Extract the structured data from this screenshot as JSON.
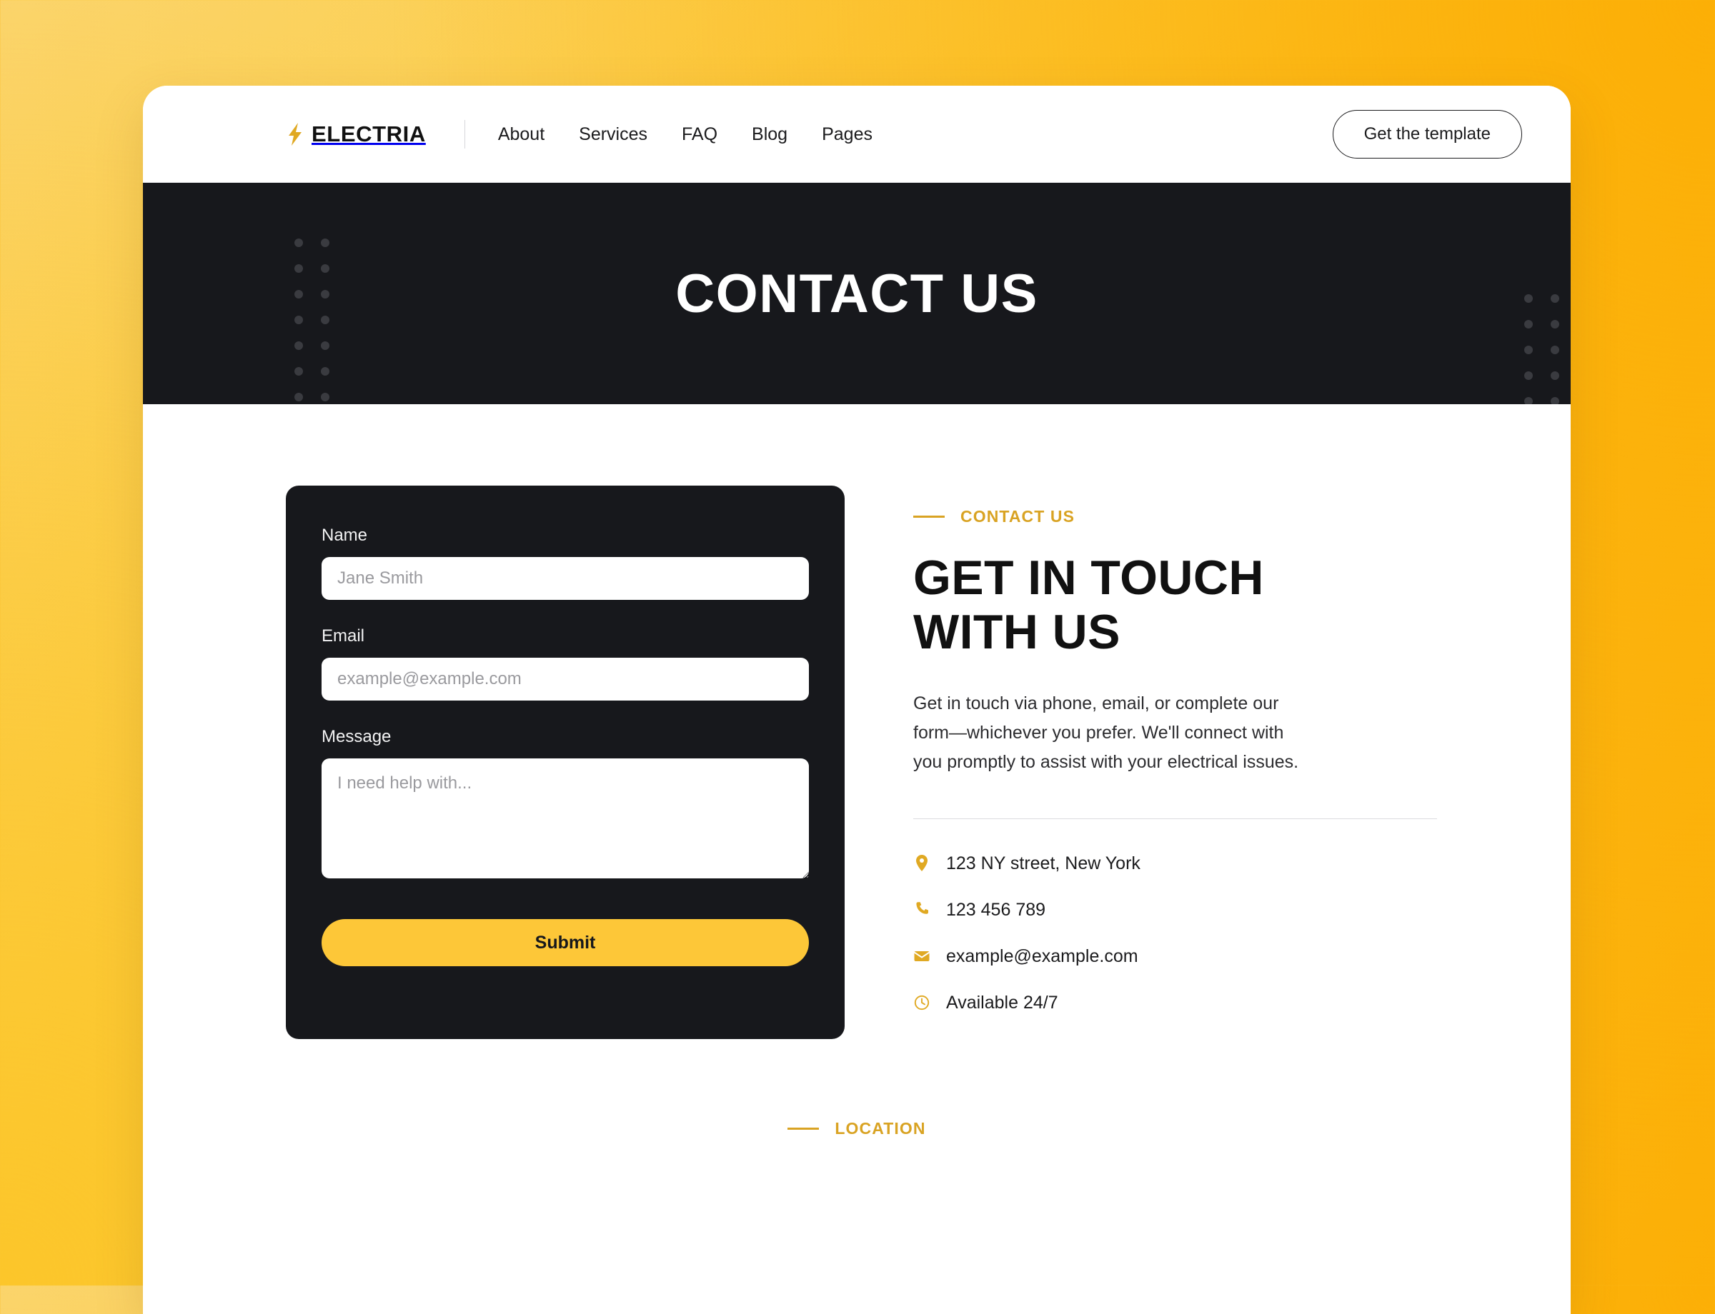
{
  "theme": {
    "accent": "#FDC738",
    "accent_dark": "#D9A323",
    "dark": "#17181c",
    "page_bg_top_left": "#FBD46B",
    "page_bg_top_right": "#FCAF06"
  },
  "header": {
    "brand": {
      "name": "ELECTRIA",
      "icon": "lightning-bolt-icon"
    },
    "nav": [
      {
        "label": "About"
      },
      {
        "label": "Services"
      },
      {
        "label": "FAQ"
      },
      {
        "label": "Blog"
      },
      {
        "label": "Pages"
      }
    ],
    "cta": {
      "label": "Get the template"
    }
  },
  "hero": {
    "title": "CONTACT US"
  },
  "form": {
    "name": {
      "label": "Name",
      "placeholder": "Jane Smith",
      "value": ""
    },
    "email": {
      "label": "Email",
      "placeholder": "example@example.com",
      "value": ""
    },
    "message": {
      "label": "Message",
      "placeholder": "I need help with...",
      "value": ""
    },
    "submit_label": "Submit"
  },
  "info": {
    "eyebrow": "CONTACT US",
    "heading_line1": "GET IN TOUCH",
    "heading_line2": "WITH US",
    "paragraph": "Get in touch via phone, email, or complete our form—whichever you prefer. We'll connect with you promptly to assist with your electrical issues.",
    "details": [
      {
        "icon": "location-pin-icon",
        "text": "123 NY street, New York"
      },
      {
        "icon": "phone-icon",
        "text": "123 456 789"
      },
      {
        "icon": "envelope-icon",
        "text": "example@example.com"
      },
      {
        "icon": "clock-icon",
        "text": "Available 24/7"
      }
    ]
  },
  "location": {
    "eyebrow": "LOCATION"
  }
}
